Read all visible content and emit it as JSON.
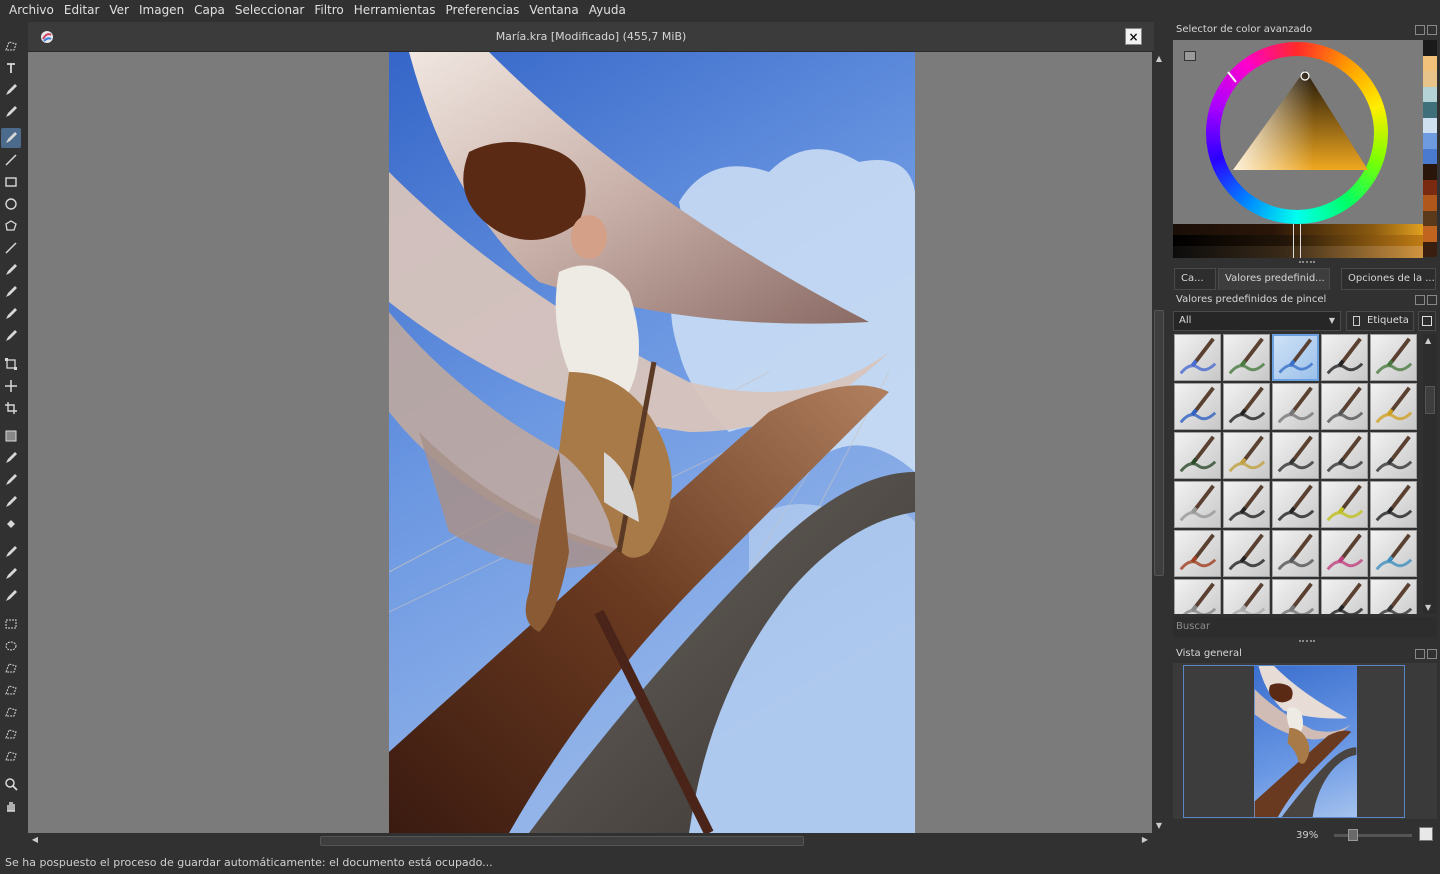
{
  "menu": [
    "Archivo",
    "Editar",
    "Ver",
    "Imagen",
    "Capa",
    "Seleccionar",
    "Filtro",
    "Herramientas",
    "Preferencias",
    "Ventana",
    "Ayuda"
  ],
  "document": {
    "title": "María.kra [Modificado]  (455,7 MiB)",
    "close_label": "×"
  },
  "tools": [
    "select-shapes-icon",
    "text-icon",
    "edit-shapes-icon",
    "calligraphy-icon",
    "freehand-brush-icon",
    "line-icon",
    "rectangle-icon",
    "ellipse-icon",
    "polygon-icon",
    "polyline-icon",
    "bezier-icon",
    "freehand-path-icon",
    "dynamic-brush-icon",
    "multibrush-icon",
    "transform-icon",
    "move-icon",
    "crop-icon",
    "gradient-icon",
    "color-sampler-icon",
    "smart-patch-icon",
    "colorize-mask-icon",
    "fill-icon",
    "assistant-icon",
    "measure-icon",
    "reference-icon",
    "rect-select-icon",
    "ellipse-select-icon",
    "polygon-select-icon",
    "freehand-select-icon",
    "contiguous-select-icon",
    "similar-select-icon",
    "bezier-select-icon",
    "zoom-icon",
    "pan-icon"
  ],
  "color_selector": {
    "title": "Selector de color avanzado",
    "swatches": [
      "#1a1a1a",
      "#f3c27a",
      "#e9c48a",
      "#b5d2d6",
      "#3f6f78",
      "#cfe0f0",
      "#6e9be0",
      "#4a7ad0",
      "#2a150a",
      "#7a2a10",
      "#b0581c",
      "#5a3a1a",
      "#c06420",
      "#3a1f10"
    ]
  },
  "tabs": [
    "Ca...",
    "Valores predefinid...",
    "Opciones de la ..."
  ],
  "brush_presets": {
    "title": "Valores predefinidos de pincel",
    "filter_value": "All",
    "tag_label": "Etiqueta",
    "search_placeholder": "Buscar",
    "presets": [
      "brush-preset-blue-wet",
      "brush-preset-green-wet",
      "brush-preset-blue-flat",
      "brush-preset-black-wet",
      "brush-preset-green-dry",
      "pencil-preset-blue",
      "pencil-preset-black",
      "pencil-preset-grey",
      "pencil-preset-mech",
      "pencil-preset-yellow",
      "charcoal-preset-green",
      "zigzag-preset",
      "scribble-preset-1",
      "scribble-preset-2",
      "scribble-preset-3",
      "airbrush-preset-soft",
      "ink-pen-preset-1",
      "ink-pen-preset-2",
      "marker-preset-yellow",
      "fountain-pen-preset",
      "paint-brush-preset-1",
      "paint-brush-preset-2",
      "blender-preset-1",
      "marker-preset-pink",
      "marker-preset-blue",
      "eraser-preset-1",
      "eraser-preset-2",
      "eraser-preset-3",
      "liner-preset",
      "fan-brush-preset"
    ]
  },
  "overview": {
    "title": "Vista general",
    "zoom": "39%"
  },
  "status": {
    "message": "Se ha pospuesto el proceso de guardar automáticamente: el documento está ocupado..."
  }
}
